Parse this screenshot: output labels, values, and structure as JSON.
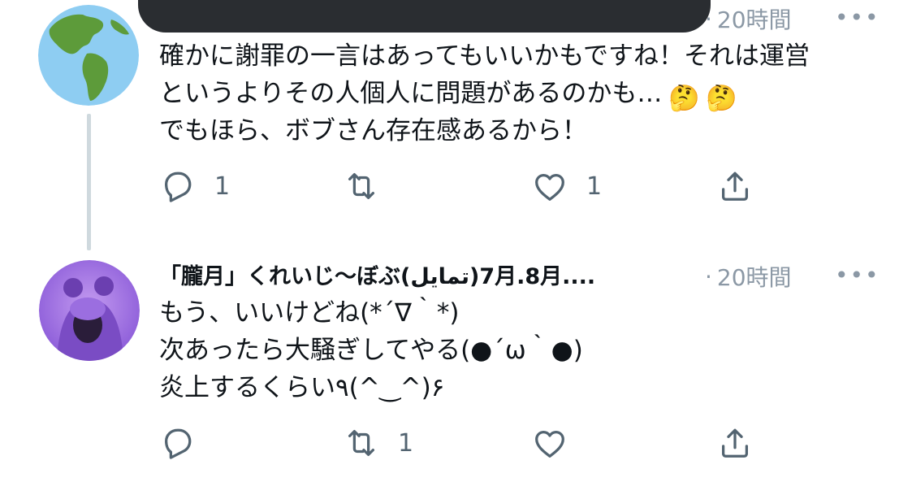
{
  "tweet1": {
    "time": "20時間",
    "text_lines": [
      "確かに謝罪の一言はあってもいいかもですね！それは運営",
      "というよりその人個人に問題があるのかも…",
      "でもほら、ボブさん存在感あるから！"
    ],
    "emoji": [
      "🤔",
      "🤔"
    ],
    "reply_count": "1",
    "like_count": "1"
  },
  "tweet2": {
    "author": "「朧月」くれいじ〜ぼぶ(تمايل)7月.8月....",
    "time": "20時間",
    "text_lines": [
      "もう、いいけどね(*´∇｀*)",
      "次あったら大騒ぎしてやる(●´ω｀●)",
      "炎上するくらい٩(^‿^)۶"
    ],
    "retweet_count": "1"
  },
  "ui": {
    "separator": "·",
    "more": "•••"
  },
  "icons": [
    "reply-icon",
    "retweet-icon",
    "like-icon",
    "share-icon",
    "more-icon"
  ],
  "colors": {
    "icon_gray": "#536471",
    "meta_gray": "#8b98a5",
    "thread_line": "#cfd9de"
  }
}
